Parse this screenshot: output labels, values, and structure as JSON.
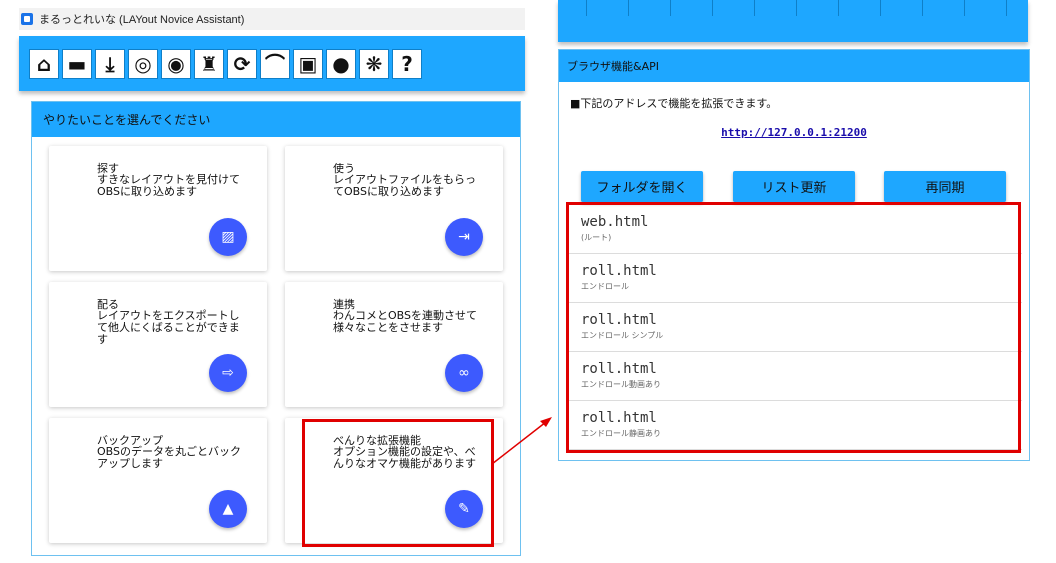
{
  "left_window": {
    "title": "まるっとれいな (LAYout Novice Assistant)",
    "toolbar_icons": [
      {
        "name": "home-icon",
        "glyph": "⌂"
      },
      {
        "name": "folder-icon",
        "glyph": "▬"
      },
      {
        "name": "download-icon",
        "glyph": "⤓"
      },
      {
        "name": "obs-icon",
        "glyph": "◎"
      },
      {
        "name": "onecomme-icon",
        "glyph": "◉"
      },
      {
        "name": "robot-icon",
        "glyph": "♜"
      },
      {
        "name": "sync-icon",
        "glyph": "⟳"
      },
      {
        "name": "chair-icon",
        "glyph": "⌒"
      },
      {
        "name": "twitch-icon",
        "glyph": "▣"
      },
      {
        "name": "cat-icon",
        "glyph": "●"
      },
      {
        "name": "paw-icon",
        "glyph": "❋"
      },
      {
        "name": "help-icon",
        "glyph": "?"
      }
    ],
    "panel_header": "やりたいことを選んでください",
    "cards": [
      {
        "title": "探す",
        "desc": "すきなレイアウトを見付けてOBSに取り込めます",
        "icon": "image-search-icon",
        "glyph": "▨"
      },
      {
        "title": "使う",
        "desc": "レイアウトファイルをもらってOBSに取り込めます",
        "icon": "import-icon",
        "glyph": "⇥"
      },
      {
        "title": "配る",
        "desc": "レイアウトをエクスポートして他人にくばることができます",
        "icon": "export-icon",
        "glyph": "⇨"
      },
      {
        "title": "連携",
        "desc": "わんコメとOBSを連動させて様々なことをさせます",
        "icon": "link-icon",
        "glyph": "∞"
      },
      {
        "title": "バックアップ",
        "desc": "OBSのデータを丸ごとバックアップします",
        "icon": "upload-icon",
        "glyph": "▲"
      },
      {
        "title": "べんりな拡張機能",
        "desc": "オプション機能の設定や、べんりなオマケ機能があります",
        "icon": "plugin-icon",
        "glyph": "✎"
      }
    ]
  },
  "right_window": {
    "header": "ブラウザ機能&API",
    "info": "■下記のアドレスで機能を拡張できます。",
    "url": "http://127.0.0.1:21200",
    "buttons": [
      "フォルダを開く",
      "リスト更新",
      "再同期"
    ],
    "files": [
      {
        "name": "web.html",
        "sub": "(ルート)"
      },
      {
        "name": "roll.html",
        "sub": "エンドロール"
      },
      {
        "name": "roll.html",
        "sub": "エンドロール シンプル"
      },
      {
        "name": "roll.html",
        "sub": "エンドロール動画あり"
      },
      {
        "name": "roll.html",
        "sub": "エンドロール静画あり"
      }
    ]
  },
  "colors": {
    "accent": "#1ea7ff",
    "fab": "#3d5afe",
    "highlight": "#e00000"
  }
}
